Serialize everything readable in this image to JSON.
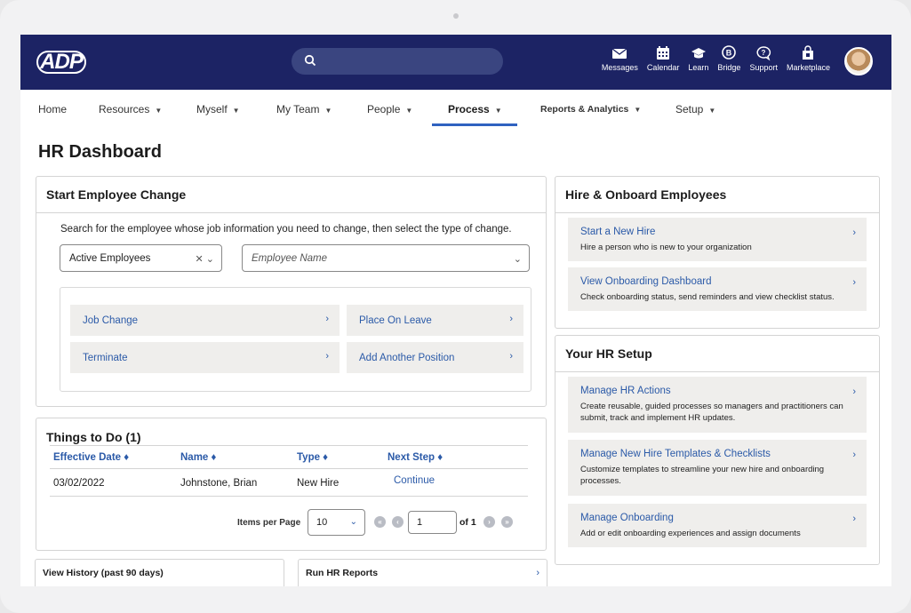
{
  "header": {
    "logo_text": "ADP",
    "search_placeholder": "",
    "tools": [
      {
        "label": "Messages",
        "icon": "envelope-icon"
      },
      {
        "label": "Calendar",
        "icon": "calendar-icon"
      },
      {
        "label": "Learn",
        "icon": "graduation-cap-icon"
      },
      {
        "label": "Bridge",
        "icon": "bridge-icon"
      },
      {
        "label": "Support",
        "icon": "speech-bubble-icon"
      },
      {
        "label": "Marketplace",
        "icon": "shop-bag-icon"
      }
    ]
  },
  "nav": {
    "items": [
      "Home",
      "Resources",
      "Myself",
      "My Team",
      "People",
      "Process",
      "Reports & Analytics",
      "Setup"
    ],
    "active": "Process"
  },
  "page": {
    "title": "HR Dashboard"
  },
  "employee_change": {
    "title": "Start Employee Change",
    "hint": "Search for the employee whose job information you need to change, then select the type of change.",
    "filter_value": "Active Employees",
    "employee_placeholder": "Employee Name",
    "actions": [
      "Job Change",
      "Place On Leave",
      "Terminate",
      "Add Another Position"
    ]
  },
  "todo": {
    "title": "Things to Do (1)",
    "columns": [
      "Effective Date ♦",
      "Name ♦",
      "Type ♦",
      "Next Step ♦"
    ],
    "rows": [
      {
        "date": "03/02/2022",
        "name": "Johnstone, Brian",
        "type": "New Hire",
        "step": "Continue"
      }
    ],
    "pager": {
      "label": "Items per Page",
      "per_page": "10",
      "page": "1",
      "of": "of 1"
    }
  },
  "bottom": {
    "history": "View History (past 90 days)",
    "reports": "Run HR Reports"
  },
  "hire": {
    "title": "Hire & Onboard Employees",
    "cards": [
      {
        "title": "Start a New Hire",
        "desc": "Hire a person who is new to your organization"
      },
      {
        "title": "View Onboarding Dashboard",
        "desc": "Check onboarding status, send reminders and view checklist status."
      }
    ]
  },
  "setup": {
    "title": "Your HR Setup",
    "cards": [
      {
        "title": "Manage HR Actions",
        "desc": "Create reusable, guided processes so managers and practitioners can submit, track and implement HR updates."
      },
      {
        "title": "Manage New Hire Templates & Checklists",
        "desc": "Customize templates to streamline your new hire and onboarding processes."
      },
      {
        "title": "Manage Onboarding",
        "desc": "Add or edit onboarding experiences and assign documents"
      }
    ]
  },
  "colors": {
    "topbar": "#1c2364",
    "link": "#2b5aa8",
    "active_underline": "#2f62c0"
  }
}
